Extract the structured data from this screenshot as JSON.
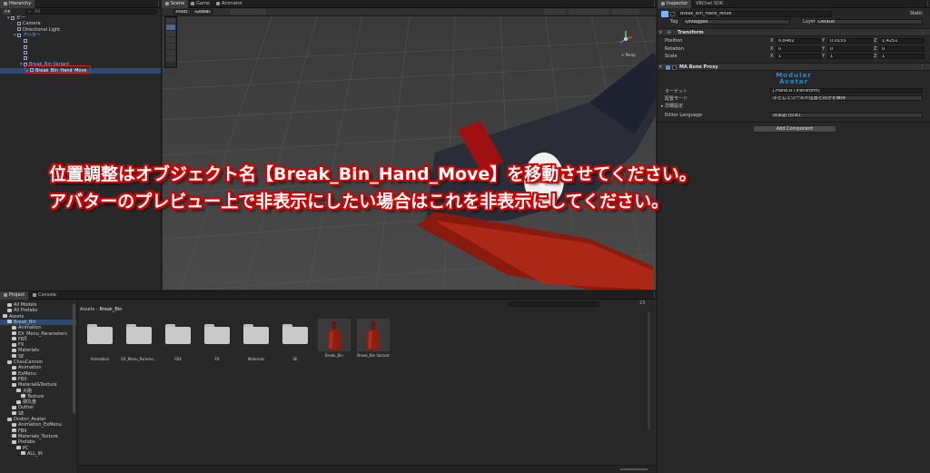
{
  "hierarchy": {
    "tab": "Hierarchy",
    "search_placeholder": "All",
    "rows": [
      {
        "label": "ビー",
        "indent": 0,
        "arrow": "▾",
        "style": "scene"
      },
      {
        "label": "Camera",
        "indent": 1,
        "arrow": "",
        "style": "normal"
      },
      {
        "label": "Directional Light",
        "indent": 1,
        "arrow": "",
        "style": "normal"
      },
      {
        "label": "アバター",
        "indent": 1,
        "arrow": "▾",
        "style": "blue"
      },
      {
        "label": "",
        "indent": 2,
        "arrow": "",
        "style": "normal"
      },
      {
        "label": "",
        "indent": 2,
        "arrow": "",
        "style": "normal"
      },
      {
        "label": "",
        "indent": 2,
        "arrow": "",
        "style": "normal"
      },
      {
        "label": "",
        "indent": 2,
        "arrow": "",
        "style": "normal"
      },
      {
        "label": "Break_Bin Variant",
        "indent": 2,
        "arrow": "▾",
        "style": "blue"
      },
      {
        "label": "Break_Bin_Hand_Move",
        "indent": 3,
        "arrow": "▸",
        "style": "selected"
      }
    ]
  },
  "scene": {
    "tabs": [
      "Scene",
      "Game",
      "Animator"
    ],
    "toolbar": {
      "shading": "Pivot",
      "space": "Global",
      "persp_label": "< Persp"
    }
  },
  "caption": {
    "line1": "位置調整はオブジェクト名【Break_Bin_Hand_Move】を移動させてください。",
    "line2": "アバターのプレビュー上で非表示にしたい場合はこれを非表示にしてください。"
  },
  "inspector": {
    "tabs": [
      "Inspector",
      "VRChat SDK"
    ],
    "object_name": "Break_Bin_Hand_Move",
    "static_label": "Static",
    "tag_label": "Tag",
    "tag_value": "Untagged",
    "layer_label": "Layer",
    "layer_value": "Default",
    "transform": {
      "title": "Transform",
      "position_label": "Position",
      "rotation_label": "Rotation",
      "scale_label": "Scale",
      "position": {
        "x": "0.8482",
        "y": "0.0155",
        "z": "1.4251"
      },
      "rotation": {
        "x": "0",
        "y": "0",
        "z": "0"
      },
      "scale": {
        "x": "1",
        "y": "1",
        "z": "1"
      }
    },
    "bone_proxy": {
      "title": "MA Bone Proxy",
      "logo_line1": "Modular",
      "logo_line2": "Avatar",
      "target_label": "ターゲット",
      "target_value": "J.Hand.R (Transform)",
      "mode_label": "配置モード",
      "mode_value": "子としてワールド位置と向きを維持",
      "advanced_label": "▸ 詳細設定",
      "lang_label": "Editor Language",
      "lang_value": "日本語 (日本)"
    },
    "add_component": "Add Component"
  },
  "project": {
    "tabs": [
      "Project",
      "Console"
    ],
    "breadcrumb": [
      "Assets",
      "Break_Bin"
    ],
    "count": "23",
    "tree": [
      {
        "label": "All Models",
        "indent": 1,
        "folder": true,
        "sel": false
      },
      {
        "label": "All Prefabs",
        "indent": 1,
        "folder": true,
        "sel": false
      },
      {
        "label": "Assets",
        "indent": 0,
        "folder": true,
        "sel": false
      },
      {
        "label": "Break_Bin",
        "indent": 1,
        "folder": true,
        "sel": true
      },
      {
        "label": "Animation",
        "indent": 2,
        "folder": true,
        "sel": false
      },
      {
        "label": "EX_Menu_Parameters",
        "indent": 2,
        "folder": true,
        "sel": false
      },
      {
        "label": "FBX",
        "indent": 2,
        "folder": true,
        "sel": false
      },
      {
        "label": "FX",
        "indent": 2,
        "folder": true,
        "sel": false
      },
      {
        "label": "Materials",
        "indent": 2,
        "folder": true,
        "sel": false
      },
      {
        "label": "SE",
        "indent": 2,
        "folder": true,
        "sel": false
      },
      {
        "label": "ChouCannon",
        "indent": 1,
        "folder": true,
        "sel": false
      },
      {
        "label": "Animation",
        "indent": 2,
        "folder": true,
        "sel": false
      },
      {
        "label": "ExMenu",
        "indent": 2,
        "folder": true,
        "sel": false
      },
      {
        "label": "FBX",
        "indent": 2,
        "folder": true,
        "sel": false
      },
      {
        "label": "Material&Texture",
        "indent": 2,
        "folder": true,
        "sel": false
      },
      {
        "label": "大砲",
        "indent": 3,
        "folder": true,
        "sel": false
      },
      {
        "label": "Texture",
        "indent": 4,
        "folder": true,
        "sel": false
      },
      {
        "label": "弾丸巻",
        "indent": 3,
        "folder": true,
        "sel": false
      },
      {
        "label": "Outher",
        "indent": 2,
        "folder": true,
        "sel": false
      },
      {
        "label": "SE",
        "indent": 2,
        "folder": true,
        "sel": false
      },
      {
        "label": "Ondori_Avatar",
        "indent": 1,
        "folder": true,
        "sel": false
      },
      {
        "label": "Animation_ExMenu",
        "indent": 2,
        "folder": true,
        "sel": false
      },
      {
        "label": "FBX",
        "indent": 2,
        "folder": true,
        "sel": false
      },
      {
        "label": "Materials_Texture",
        "indent": 2,
        "folder": true,
        "sel": false
      },
      {
        "label": "Prefabs",
        "indent": 2,
        "folder": true,
        "sel": false
      },
      {
        "label": "PC",
        "indent": 3,
        "folder": true,
        "sel": false
      },
      {
        "label": "ALL_IN",
        "indent": 4,
        "folder": true,
        "sel": false
      }
    ],
    "assets": [
      {
        "label": "Animation",
        "kind": "folder"
      },
      {
        "label": "EX_Menu_Parame...",
        "kind": "folder"
      },
      {
        "label": "FBX",
        "kind": "folder"
      },
      {
        "label": "FX",
        "kind": "folder"
      },
      {
        "label": "Materials",
        "kind": "folder"
      },
      {
        "label": "SE",
        "kind": "folder"
      },
      {
        "label": "Break_Bin",
        "kind": "prefab"
      },
      {
        "label": "Break_Bin Variant",
        "kind": "prefab"
      }
    ]
  },
  "colors": {
    "accent": "#2d4a73",
    "caption_outline": "#d40000",
    "highlight_box": "#e02020"
  }
}
